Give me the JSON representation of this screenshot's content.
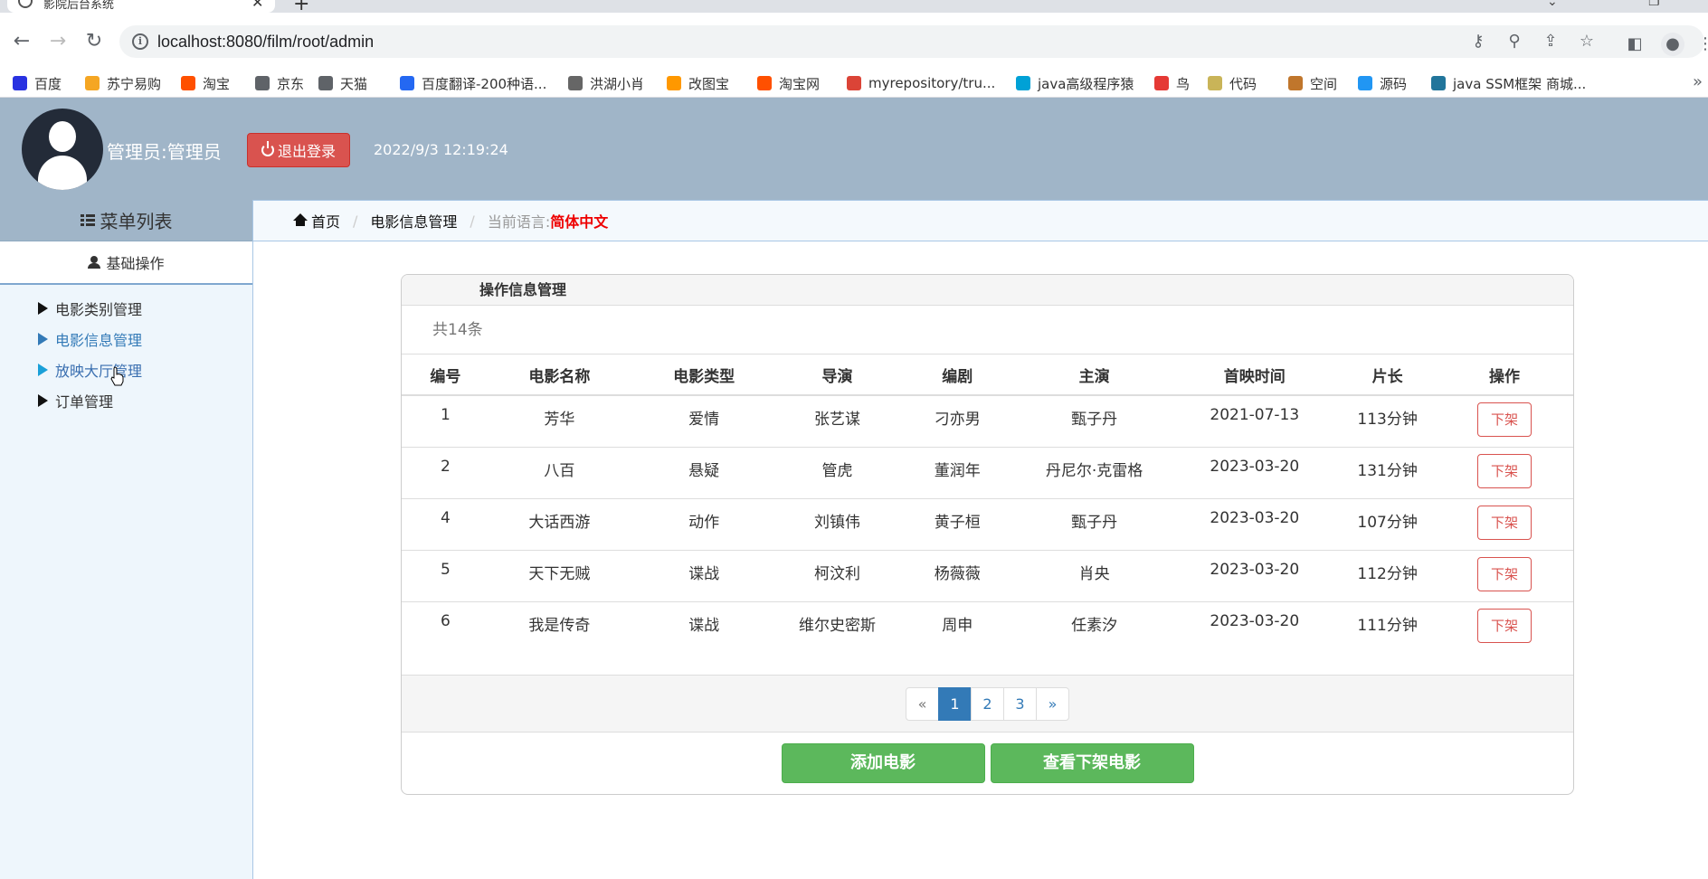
{
  "browser": {
    "tab_title": "影院后台系统",
    "url": "localhost:8080/film/root/admin",
    "bookmarks": [
      {
        "icon": "baidu-icon",
        "color": "#2932e1",
        "label": "百度"
      },
      {
        "icon": "suning-icon",
        "color": "#f5a623",
        "label": "苏宁易购"
      },
      {
        "icon": "taobao-icon",
        "color": "#ff5000",
        "label": "淘宝"
      },
      {
        "icon": "globe-icon",
        "color": "#5f6368",
        "label": "京东"
      },
      {
        "icon": "globe-icon",
        "color": "#5f6368",
        "label": "天猫"
      },
      {
        "icon": "translate-icon",
        "color": "#2468f2",
        "label": "百度翻译-200种语..."
      },
      {
        "icon": "bird-icon",
        "color": "#666666",
        "label": "洪湖小肖"
      },
      {
        "icon": "image-icon",
        "color": "#ff9800",
        "label": "改图宝"
      },
      {
        "icon": "taobao-icon",
        "color": "#ff5000",
        "label": "淘宝网"
      },
      {
        "icon": "chrome-icon",
        "color": "#db4437",
        "label": "myrepository/tru..."
      },
      {
        "icon": "bilibili-icon",
        "color": "#00a1d6",
        "label": "java高级程序猿"
      },
      {
        "icon": "bird-icon",
        "color": "#e53935",
        "label": "鸟"
      },
      {
        "icon": "code-icon",
        "color": "#c9b458",
        "label": "代码"
      },
      {
        "icon": "space-icon",
        "color": "#c0762c",
        "label": "空间"
      },
      {
        "icon": "source-icon",
        "color": "#2196f3",
        "label": "源码"
      },
      {
        "icon": "wordpress-icon",
        "color": "#21759b",
        "label": "java SSM框架 商城..."
      }
    ]
  },
  "header": {
    "admin_label": "管理员:管理员",
    "logout_label": "退出登录",
    "datetime": "2022/9/3 12:19:24"
  },
  "sidebar": {
    "title": "菜单列表",
    "section": "基础操作",
    "items": [
      {
        "label": "电影类别管理"
      },
      {
        "label": "电影信息管理"
      },
      {
        "label": "放映大厅管理"
      },
      {
        "label": "订单管理"
      }
    ]
  },
  "breadcrumb": {
    "home": "首页",
    "current": "电影信息管理",
    "lang_label": "当前语言:",
    "lang_value": "简体中文"
  },
  "panel": {
    "title": "操作信息管理",
    "count": "共14条",
    "columns": [
      "编号",
      "电影名称",
      "电影类型",
      "导演",
      "编剧",
      "主演",
      "首映时间",
      "片长",
      "操作"
    ],
    "rows": [
      {
        "id": "1",
        "name": "芳华",
        "type": "爱情",
        "director": "张艺谋",
        "writer": "刁亦男",
        "star": "甄子丹",
        "date": "2021-07-13",
        "length": "113分钟",
        "action": "下架"
      },
      {
        "id": "2",
        "name": "八百",
        "type": "悬疑",
        "director": "管虎",
        "writer": "董润年",
        "star": "丹尼尔·克雷格",
        "date": "2023-03-20",
        "length": "131分钟",
        "action": "下架"
      },
      {
        "id": "4",
        "name": "大话西游",
        "type": "动作",
        "director": "刘镇伟",
        "writer": "黄子桓",
        "star": "甄子丹",
        "date": "2023-03-20",
        "length": "107分钟",
        "action": "下架"
      },
      {
        "id": "5",
        "name": "天下无贼",
        "type": "谍战",
        "director": "柯汶利",
        "writer": "杨薇薇",
        "star": "肖央",
        "date": "2023-03-20",
        "length": "112分钟",
        "action": "下架"
      },
      {
        "id": "6",
        "name": "我是传奇",
        "type": "谍战",
        "director": "维尔史密斯",
        "writer": "周申",
        "star": "任素汐",
        "date": "2023-03-20",
        "length": "111分钟",
        "action": "下架"
      }
    ],
    "pager": [
      "«",
      "1",
      "2",
      "3",
      "»"
    ],
    "active_page": "1",
    "add_button": "添加电影",
    "view_off_button": "查看下架电影"
  },
  "colors": {
    "header_bg": "#a0b5c8",
    "danger": "#d9534f",
    "primary": "#337ab7",
    "success": "#5cb85c",
    "lang_highlight": "#ee0000"
  }
}
